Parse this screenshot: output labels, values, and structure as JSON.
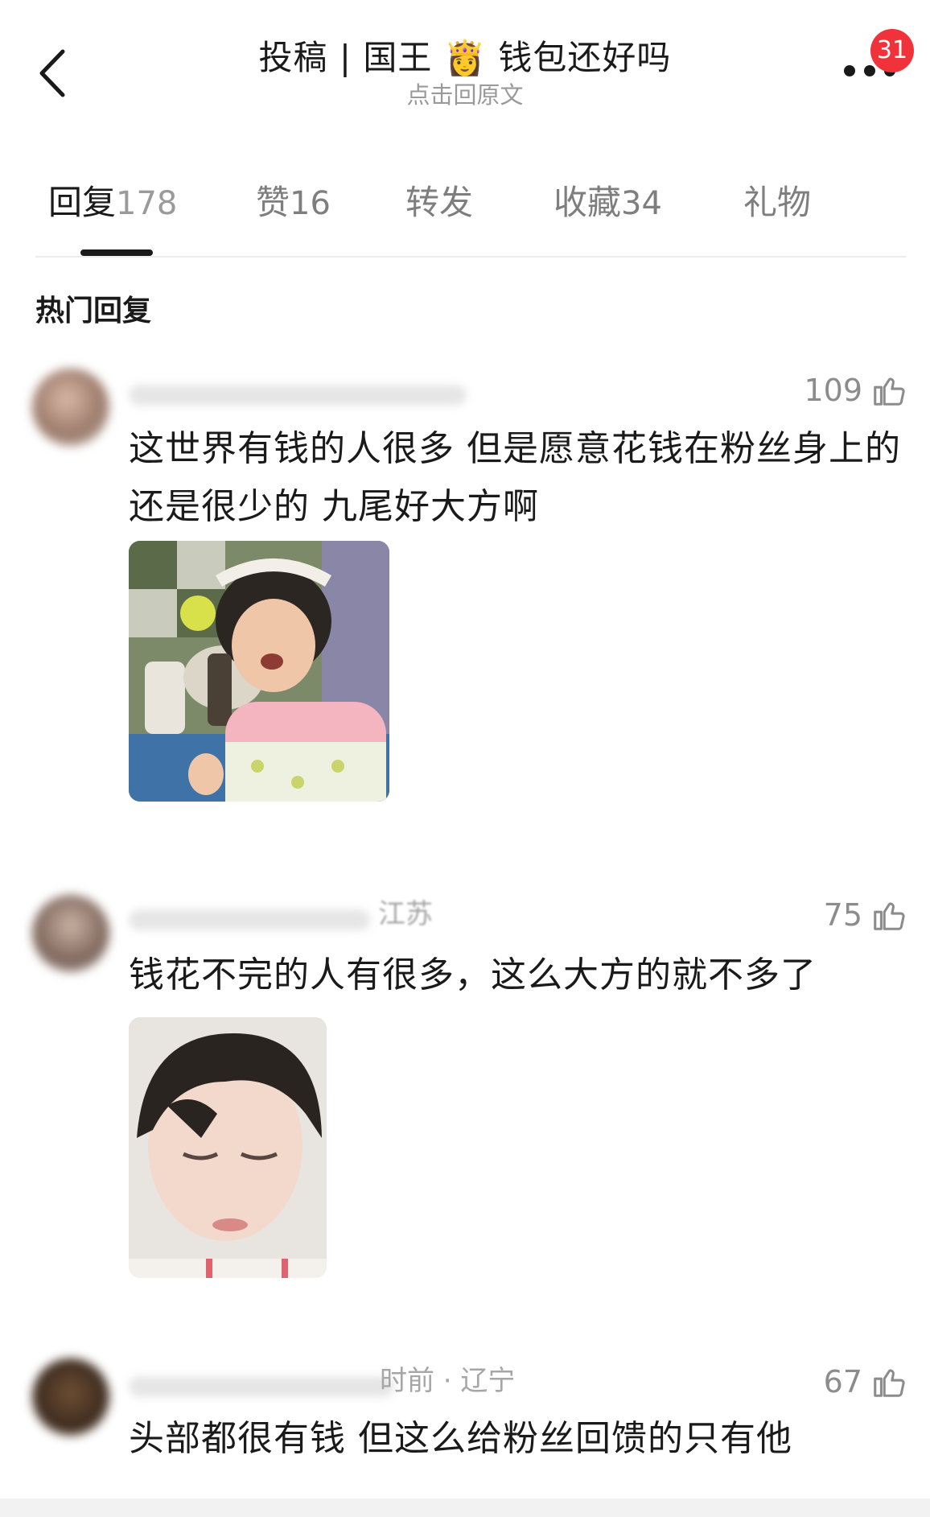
{
  "header": {
    "back_icon": "chevron-left-icon",
    "title_prefix": "投稿 | 国王",
    "title_emoji": "👸",
    "title_suffix": "钱包还好吗",
    "subtitle": "点击回原文",
    "more_icon": "more-dots-icon",
    "badge_count": "31"
  },
  "tabs": [
    {
      "label": "回复",
      "count": "178",
      "active": true
    },
    {
      "label": "赞",
      "count": "16"
    },
    {
      "label": "转发",
      "count": ""
    },
    {
      "label": "收藏",
      "count": "34"
    },
    {
      "label": "礼物",
      "count": ""
    }
  ],
  "section_title": "热门回复",
  "comments": [
    {
      "meta": "",
      "likes": "109",
      "text": "这世界有钱的人很多 但是愿意花钱在粉丝身上的还是很少的 九尾好大方啊",
      "image": "girl-eating-skewer-photo"
    },
    {
      "meta": "江苏",
      "likes": "75",
      "text": "钱花不完的人有很多，这么大方的就不多了",
      "image": "boy-eyes-closed-photo"
    },
    {
      "meta": "时前 · 辽宁",
      "likes": "67",
      "text": "头部都很有钱 但这么给粉丝回馈的只有他"
    }
  ],
  "colors": {
    "badge": "#f0333a",
    "text": "#1a1a1a",
    "muted": "#8c8c8c"
  }
}
